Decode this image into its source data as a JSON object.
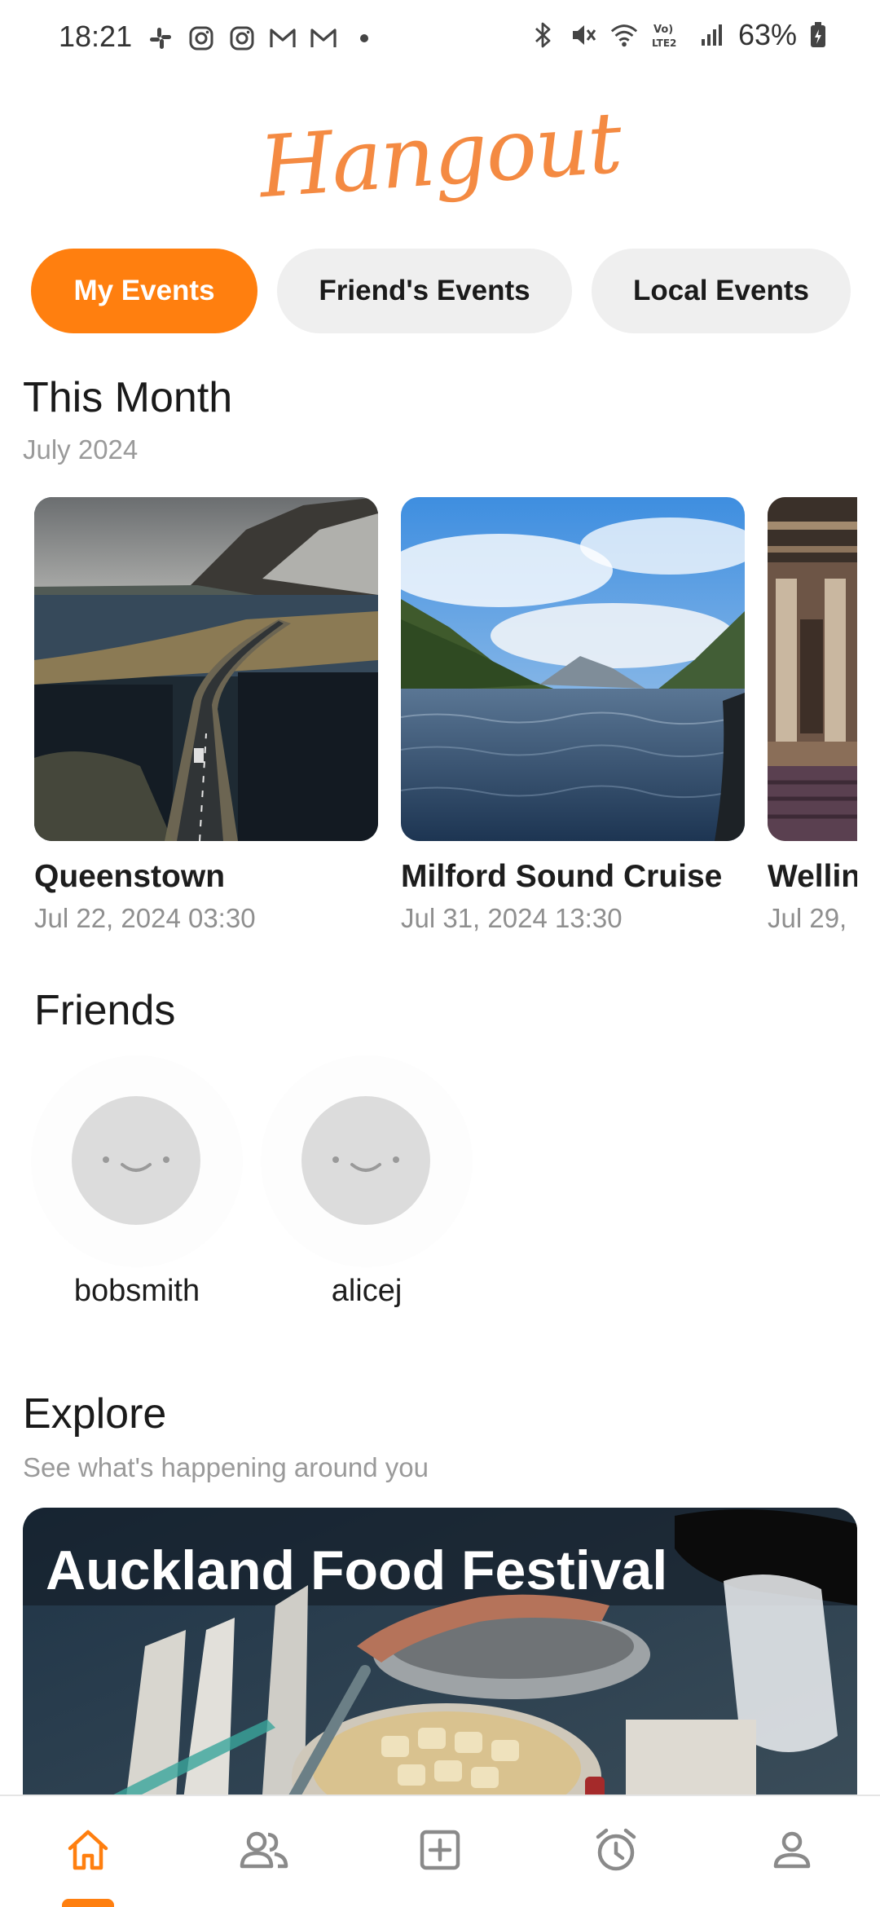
{
  "status_bar": {
    "time": "18:21",
    "left_icons": [
      "slack-icon",
      "instagram-icon",
      "instagram-icon",
      "gmail-icon",
      "gmail-icon",
      "dot-icon"
    ],
    "right_icons": [
      "bluetooth-icon",
      "mute-icon",
      "wifi-icon",
      "volte-icon",
      "signal-icon"
    ],
    "battery": "63%"
  },
  "app": {
    "logo_text": "Hangout",
    "accent_color": "#ff7f0f"
  },
  "tabs": [
    {
      "label": "My Events",
      "active": true
    },
    {
      "label": "Friend's Events",
      "active": false
    },
    {
      "label": "Local Events",
      "active": false
    }
  ],
  "this_month": {
    "title": "This Month",
    "subtitle": "July 2024",
    "events": [
      {
        "name": "Queenstown",
        "date": "Jul 22, 2024 03:30"
      },
      {
        "name": "Milford Sound Cruise",
        "date": "Jul 31, 2024 13:30"
      },
      {
        "name": "Wellin",
        "date": "Jul 29,"
      }
    ]
  },
  "friends": {
    "title": "Friends",
    "items": [
      {
        "username": "bobsmith"
      },
      {
        "username": "alicej"
      }
    ]
  },
  "explore": {
    "title": "Explore",
    "subtitle": "See what's happening around you",
    "featured_title": "Auckland Food Festival"
  },
  "bottom_nav": [
    {
      "icon": "home-icon",
      "active": true
    },
    {
      "icon": "friends-icon",
      "active": false
    },
    {
      "icon": "add-icon",
      "active": false
    },
    {
      "icon": "alarm-icon",
      "active": false
    },
    {
      "icon": "profile-icon",
      "active": false
    }
  ]
}
